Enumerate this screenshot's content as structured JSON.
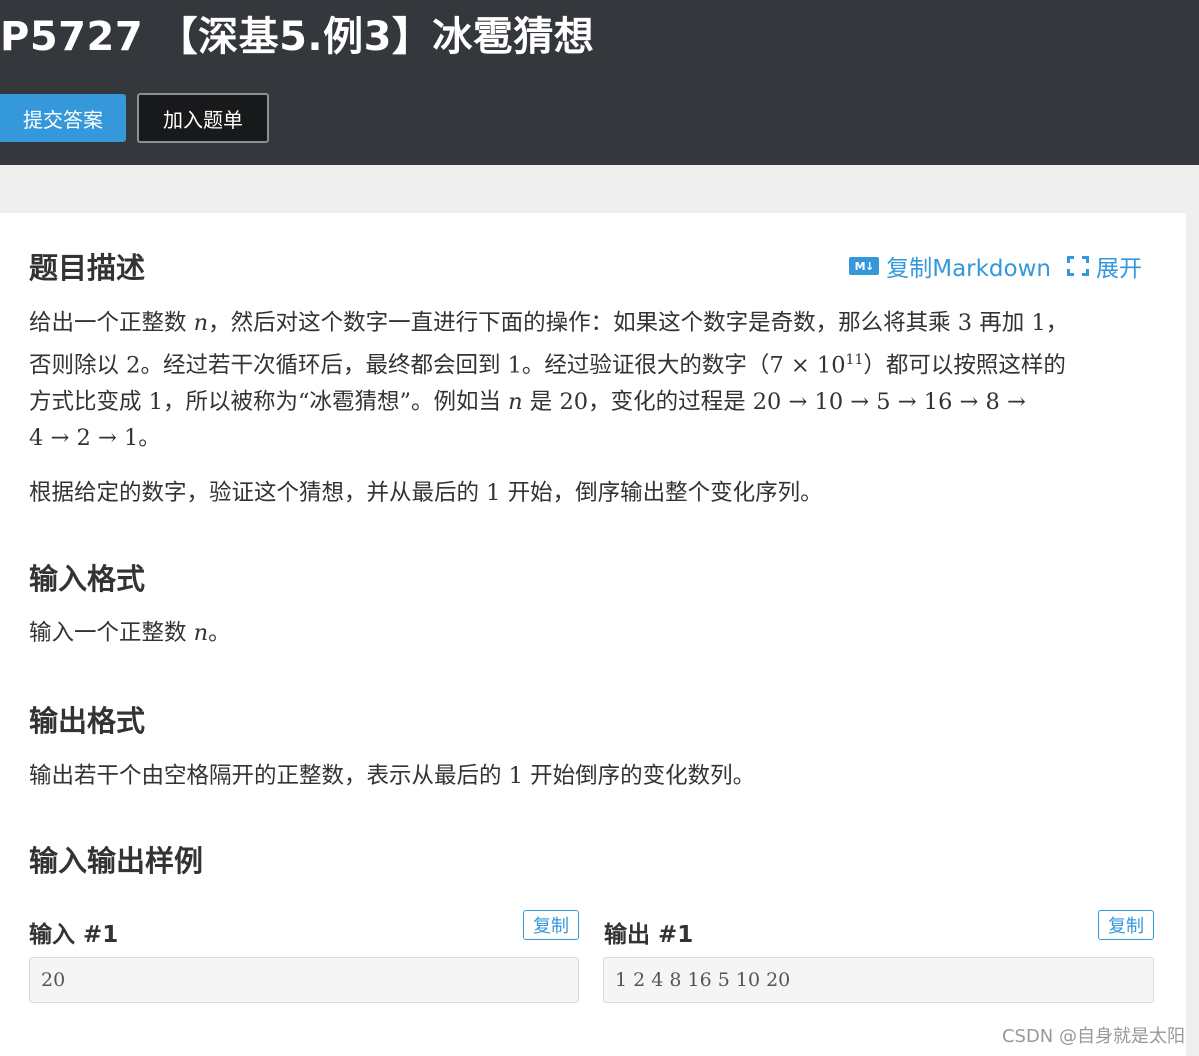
{
  "header": {
    "title": "P5727 【深基5.例3】冰雹猜想",
    "submit_label": "提交答案",
    "add_label": "加入题单"
  },
  "toolbar": {
    "md_icon_text": "M↓",
    "copy_markdown_label": "复制Markdown",
    "expand_label": "展开",
    "icons": [
      "markdown-icon",
      "expand-icon"
    ]
  },
  "description": {
    "heading": "题目描述",
    "p1_lines": [
      [
        "给出一个正整数 ",
        "n",
        "，然后对这个数字一直进行下面的操作：如果这个数字是奇数，那么将其乘 3 再加 1，"
      ],
      [
        "否则除以 2。经过若干次循环后，最终都会回到 1。经过验证很大的数字（7 × 10",
        "11",
        "）都可以按照这样的"
      ],
      [
        "方式比变成 1，所以被称为“冰雹猜想”。例如当 ",
        "n",
        " 是 20，变化的过程是 20 → 10 → 5 → 16 → 8 →"
      ],
      [
        "4 → 2 → 1。"
      ]
    ],
    "p2": "根据给定的数字，验证这个猜想，并从最后的 1 开始，倒序输出整个变化序列。"
  },
  "input_format": {
    "heading": "输入格式",
    "text_before": "输入一个正整数 ",
    "var": "n",
    "text_after": "。"
  },
  "output_format": {
    "heading": "输出格式",
    "text": "输出若干个由空格隔开的正整数，表示从最后的 1 开始倒序的变化数列。"
  },
  "samples": {
    "heading": "输入输出样例",
    "input_label": "输入 #1",
    "output_label": "输出 #1",
    "copy_label": "复制",
    "input_value": "20",
    "output_value": "1 2 4 8 16 5 10 20"
  },
  "watermark": "CSDN @自身就是太阳",
  "colors": {
    "header_bg": "#34373b",
    "accent": "#3498db",
    "page_bg": "#efefef"
  }
}
